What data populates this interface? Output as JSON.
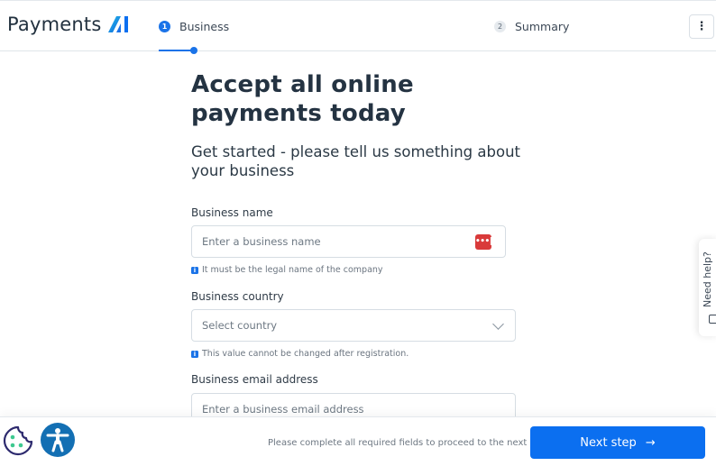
{
  "header": {
    "logo_text": "Payments",
    "logo_mark": "AI",
    "steps": [
      {
        "number": "1",
        "label": "Business",
        "state": "active"
      },
      {
        "number": "2",
        "label": "Summary",
        "state": "inactive"
      }
    ],
    "menu_icon": "more-vertical-icon",
    "menu_glyph": "⋮"
  },
  "main": {
    "title": "Accept all online payments today",
    "subtitle": "Get started - please tell us something about your business",
    "fields": [
      {
        "label": "Business name",
        "placeholder": "Enter a business name",
        "value": "",
        "hint": "It must be the legal name of the company",
        "trailing_icon": "password-manager-icon",
        "trailing_glyph": "•••|"
      },
      {
        "label": "Business country",
        "placeholder": "Select country",
        "value": "",
        "hint": "This value cannot be changed after registration.",
        "trailing_icon": "chevron-down-icon"
      },
      {
        "label": "Business email address",
        "placeholder": "Enter a business email address",
        "value": ""
      }
    ],
    "info_glyph": "i"
  },
  "help_tab": {
    "label": "Need help?",
    "icon": "chat-icon"
  },
  "footer": {
    "cookie_icon": "cookie-icon",
    "accessibility_icon": "accessibility-icon",
    "message": "Please complete all required fields to proceed to the next step",
    "next_label": "Next step",
    "next_arrow": "→"
  },
  "colors": {
    "primary": "#0b6ff0",
    "step_active": "#1a73e8",
    "password_icon": "#d93a3a",
    "accessibility": "#136fb3",
    "cookie_outline": "#2d2a6e",
    "cookie_dots": "#3ec98f"
  }
}
